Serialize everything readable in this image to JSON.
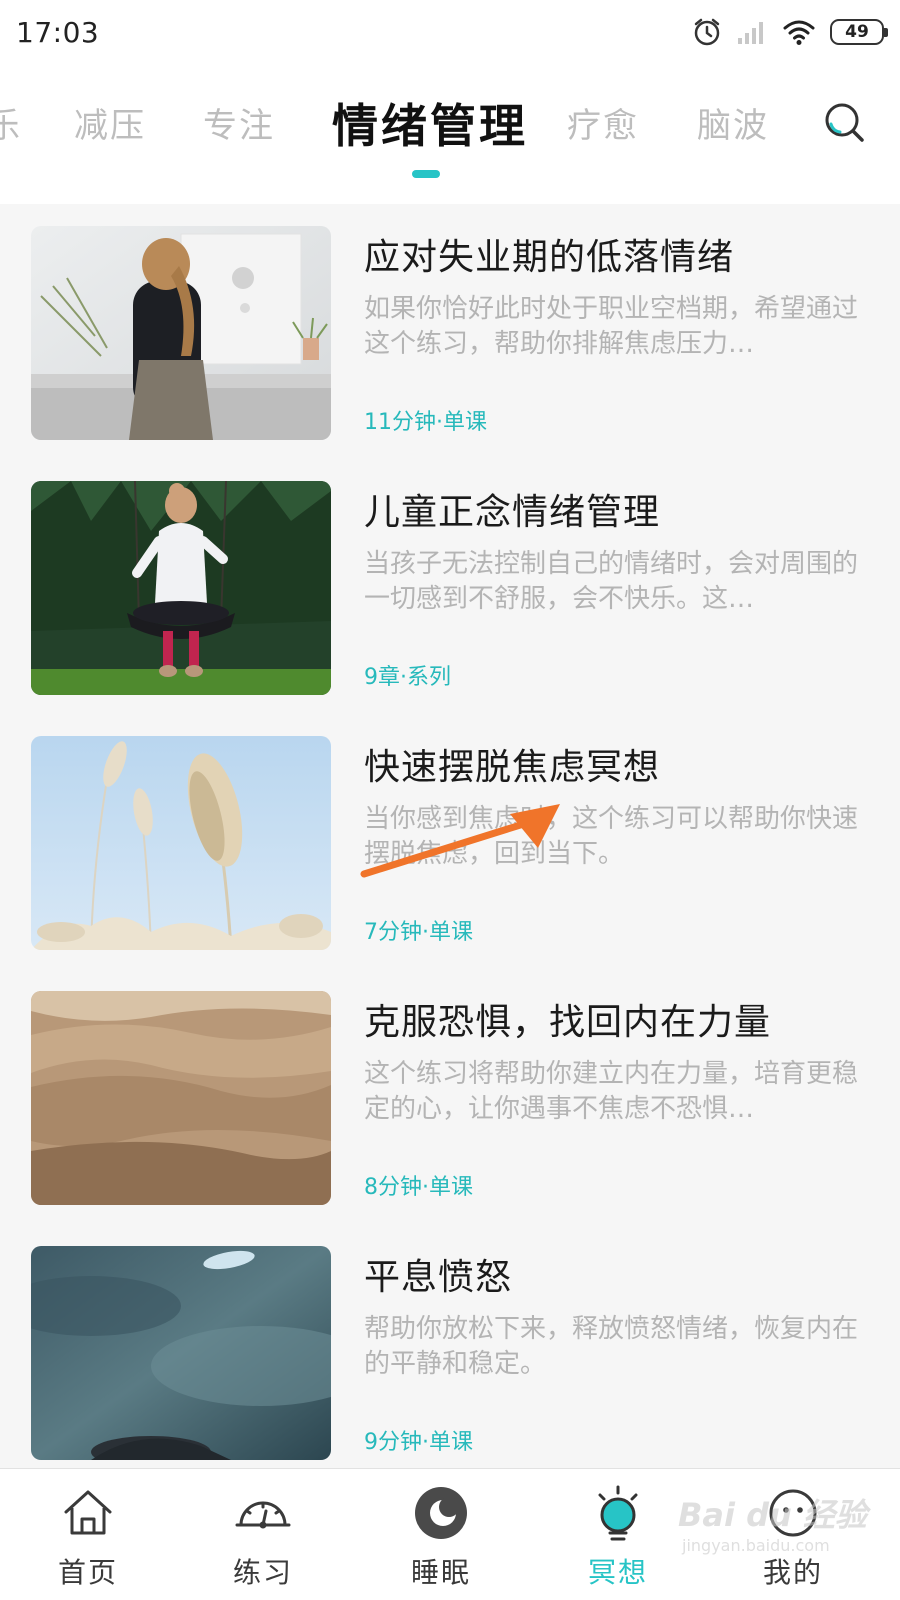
{
  "status_bar": {
    "time": "17:03",
    "battery": "49"
  },
  "tabs": {
    "items": [
      {
        "label": "乐",
        "active": false
      },
      {
        "label": "减压",
        "active": false
      },
      {
        "label": "专注",
        "active": false
      },
      {
        "label": "情绪管理",
        "active": true
      },
      {
        "label": "疗愈",
        "active": false
      },
      {
        "label": "脑波",
        "active": false
      }
    ],
    "accent_color": "#27c4c6",
    "search_icon": "search-icon"
  },
  "courses": [
    {
      "title": "应对失业期的低落情绪",
      "description": "如果你恰好此时处于职业空档期，希望通过这个练习，帮助你排解焦虑压力…",
      "meta": "11分钟·单课"
    },
    {
      "title": "儿童正念情绪管理",
      "description": "当孩子无法控制自己的情绪时，会对周围的一切感到不舒服，会不快乐。这…",
      "meta": "9章·系列"
    },
    {
      "title": "快速摆脱焦虑冥想",
      "description": "当你感到焦虑时，这个练习可以帮助你快速摆脱焦虑，回到当下。",
      "meta": "7分钟·单课"
    },
    {
      "title": "克服恐惧，找回内在力量",
      "description": "这个练习将帮助你建立内在力量，培育更稳定的心，让你遇事不焦虑不恐惧…",
      "meta": "8分钟·单课"
    },
    {
      "title": "平息愤怒",
      "description": "帮助你放松下来，释放愤怒情绪，恢复内在的平静和稳定。",
      "meta": "9分钟·单课"
    }
  ],
  "bottom_nav": [
    {
      "label": "首页",
      "icon": "home-icon"
    },
    {
      "label": "练习",
      "icon": "gauge-icon"
    },
    {
      "label": "睡眠",
      "icon": "moon-icon"
    },
    {
      "label": "冥想",
      "icon": "meditation-bulb-icon",
      "active": true
    },
    {
      "label": "我的",
      "icon": "profile-face-icon"
    }
  ],
  "watermark": {
    "main": "Bai du 经验",
    "sub": "jingyan.baidu.com"
  }
}
